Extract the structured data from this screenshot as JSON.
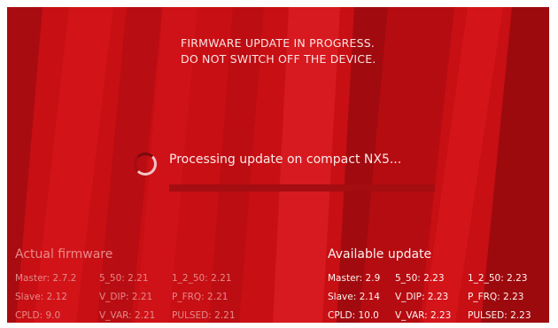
{
  "warning": {
    "line1": "FIRMWARE UPDATE IN PROGRESS.",
    "line2": "DO NOT SWITCH OFF THE DEVICE."
  },
  "status": {
    "text": "Processing update on compact NX5...",
    "progress": 0
  },
  "actual": {
    "title": "Actual firmware",
    "rows": [
      [
        "Master: 2.7.2",
        "5_50: 2.21",
        "1_2_50: 2.21"
      ],
      [
        "Slave: 2.12",
        "V_DIP: 2.21",
        "P_FRQ: 2.21"
      ],
      [
        "CPLD: 9.0",
        "V_VAR: 2.21",
        "PULSED: 2.21"
      ]
    ]
  },
  "available": {
    "title": "Available update",
    "rows": [
      [
        "Master: 2.9",
        "5_50: 2.23",
        "1_2_50: 2.23"
      ],
      [
        "Slave: 2.14",
        "V_DIP: 2.23",
        "P_FRQ: 2.23"
      ],
      [
        "CPLD: 10.0",
        "V_VAR: 2.23",
        "PULSED: 2.23"
      ]
    ]
  },
  "colors": {
    "background": "#c70f14",
    "stripe_dark": "#9c0a0e",
    "stripe_light": "#d81a1f"
  },
  "icons": {
    "spinner": "loading-spinner-icon"
  }
}
